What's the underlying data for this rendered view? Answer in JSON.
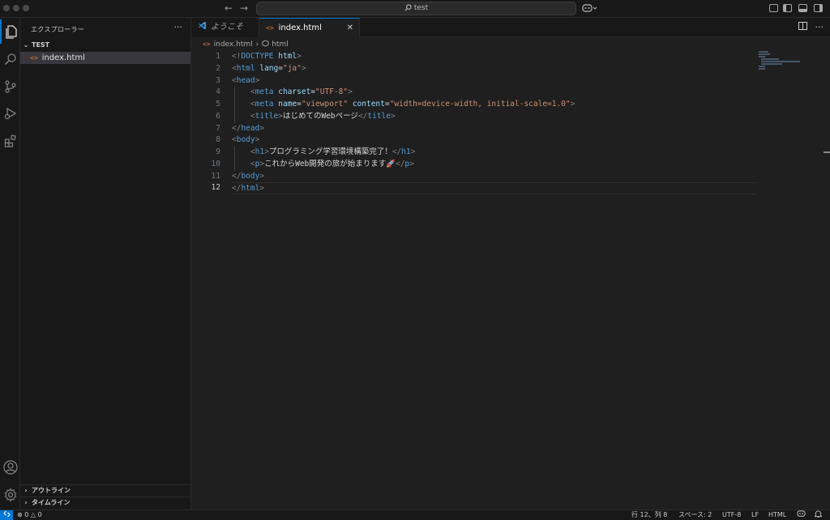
{
  "titlebar": {
    "search_text": "test"
  },
  "sidebar": {
    "title": "エクスプローラー",
    "more_label": "···",
    "folder": "TEST",
    "files": [
      "index.html"
    ],
    "outline": "アウトライン",
    "timeline": "タイムライン"
  },
  "tabs": [
    {
      "label": "ようこそ",
      "active": false
    },
    {
      "label": "index.html",
      "active": true
    }
  ],
  "breadcrumb": {
    "file": "index.html",
    "symbol": "html"
  },
  "editor": {
    "language": "html",
    "current_line": 12,
    "line_numbers": [
      "1",
      "2",
      "3",
      "4",
      "5",
      "6",
      "7",
      "8",
      "9",
      "10",
      "11",
      "12"
    ],
    "h1_text": "プログラミング学習環境構築完了！",
    "p_text": "これからWeb開発の旅が始まります🚀",
    "title_text": "はじめてのWebページ"
  },
  "statusbar": {
    "errors": "0",
    "warnings": "0",
    "position": "行 12、列 8",
    "indent": "スペース: 2",
    "encoding": "UTF-8",
    "eol": "LF",
    "language": "HTML"
  },
  "colors": {
    "accent": "#0078d4",
    "tag": "#569cd6",
    "attr": "#9cdcfe",
    "string": "#ce9178"
  }
}
